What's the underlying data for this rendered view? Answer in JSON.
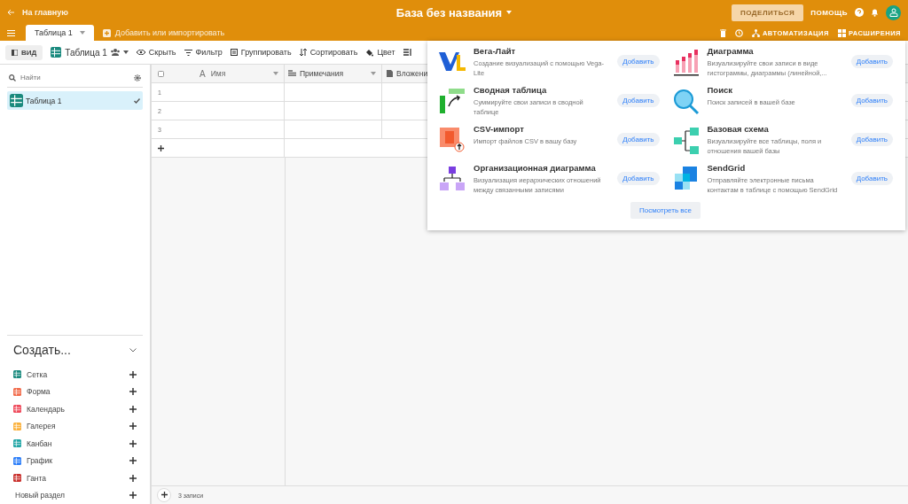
{
  "header": {
    "back_link": "На главную",
    "title": "База без названия",
    "share_button": "ПОДЕЛИТЬСЯ",
    "help": "ПОМОЩЬ",
    "automation": "АВТОМАТИЗАЦИЯ",
    "extensions": "РАСШИРЕНИЯ"
  },
  "tabs": [
    {
      "label": "Таблица 1",
      "selected": true
    }
  ],
  "add_table": "Добавить или импортировать",
  "toolbar": {
    "view_button": "ВИД",
    "view_name": "Таблица 1",
    "actions": [
      {
        "label": "Скрыть"
      },
      {
        "label": "Фильтр"
      },
      {
        "label": "Группировать"
      },
      {
        "label": "Сортировать"
      },
      {
        "label": "Цвет"
      }
    ]
  },
  "sidebar": {
    "search": {
      "placeholder": "Найти"
    },
    "views": [
      {
        "label": "Таблица 1",
        "selected": true
      }
    ],
    "create_title": "Создать...",
    "create_items": [
      {
        "label": "Сетка",
        "color": "#1a8a7e"
      },
      {
        "label": "Форма",
        "color": "#f26b4b"
      },
      {
        "label": "Календарь",
        "color": "#ef4a5b"
      },
      {
        "label": "Галерея",
        "color": "#fbb13c"
      },
      {
        "label": "Канбан",
        "color": "#21a6a6"
      },
      {
        "label": "График",
        "color": "#2d7ff9"
      },
      {
        "label": "Ганта",
        "color": "#c9302c"
      }
    ],
    "new_section": "Новый раздел"
  },
  "table": {
    "select_all": {
      "checked": false
    },
    "name_type_glyph": "A",
    "columns": [
      "Имя",
      "Примечания",
      "Вложени"
    ],
    "rows": [
      "1",
      "2",
      "3"
    ],
    "footer": "3 записи"
  },
  "extensions_popup": {
    "apps": [
      {
        "name": "Вега-Лайт",
        "description": "Создание визуализаций с помощью Vega-Lite",
        "button": "Добавить"
      },
      {
        "name": "Диаграмма",
        "description": "Визуализируйте свои записи в виде гистограммы, диаграммы (линейной,...",
        "button": "Добавить"
      },
      {
        "name": "Сводная таблица",
        "description": "Суммируйте свои записи в сводной таблице",
        "button": "Добавить"
      },
      {
        "name": "Поиск",
        "description": "Поиск записей в вашей базе",
        "button": "Добавить"
      },
      {
        "name": "CSV-импорт",
        "description": "Импорт файлов CSV в вашу базу",
        "button": "Добавить"
      },
      {
        "name": "Базовая схема",
        "description": "Визуализируйте все таблицы, поля и отношения вашей базы",
        "button": "Добавить"
      },
      {
        "name": "Организационная диаграмма",
        "description": "Визуализация иерархических отношений между связанными записями",
        "button": "Добавить"
      },
      {
        "name": "SendGrid",
        "description": "Отправляйте электронные письма контактам в таблице с помощью SendGrid",
        "button": "Добавить"
      }
    ],
    "see_all": "Посмотреть все"
  }
}
